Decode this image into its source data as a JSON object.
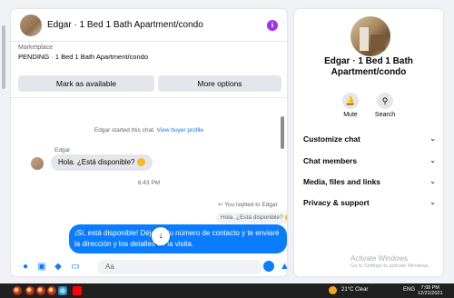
{
  "header": {
    "title": "Edgar · 1 Bed 1 Bath Apartment/condo",
    "info_glyph": "i"
  },
  "listing": {
    "label": "Marketplace",
    "status": "PENDING · 1 Bed 1 Bath Apartment/condo",
    "mark_available": "Mark as available",
    "more_options": "More options"
  },
  "thread": {
    "started": "Edgar started this chat.",
    "view_profile": "View buyer profile",
    "sender": "Edgar",
    "incoming": "Hola. ¿Está disponible?",
    "time": "6:43 PM",
    "replied": "You replied to Edgar",
    "quoted": "Hola. ¿Está disponible?",
    "outgoing": "¡Sí, está disponible! Déjame tu número de contacto y te enviaré la dirección y los detalles de la visita."
  },
  "composer": {
    "placeholder": "Aa"
  },
  "details": {
    "title": "Edgar · 1 Bed 1 Bath Apartment/condo",
    "mute_label": "Mute",
    "search_label": "Search",
    "menu": [
      "Customize chat",
      "Chat members",
      "Media, files and links",
      "Privacy & support"
    ]
  },
  "watermark": {
    "title": "Activate Windows",
    "subtitle": "Go to Settings to activate Windows."
  },
  "taskbar": {
    "weather": "21°C  Clear",
    "lang": "ENG",
    "time": "7:08 PM",
    "date": "12/21/2021"
  },
  "icons": {
    "info": "info-icon",
    "bell": "bell-icon",
    "search": "search-icon",
    "mic": "mic-icon",
    "photo": "photo-icon",
    "sticker": "sticker-icon",
    "gif": "gif-icon",
    "emoji": "emoji-icon",
    "like": "thumbs-up-icon",
    "chevron": "chevron-down-icon",
    "down": "arrow-down-icon"
  },
  "colors": {
    "accent": "#0a7cff",
    "info": "#a233e8",
    "panel": "#ffffff",
    "background": "#f0f2f5"
  }
}
